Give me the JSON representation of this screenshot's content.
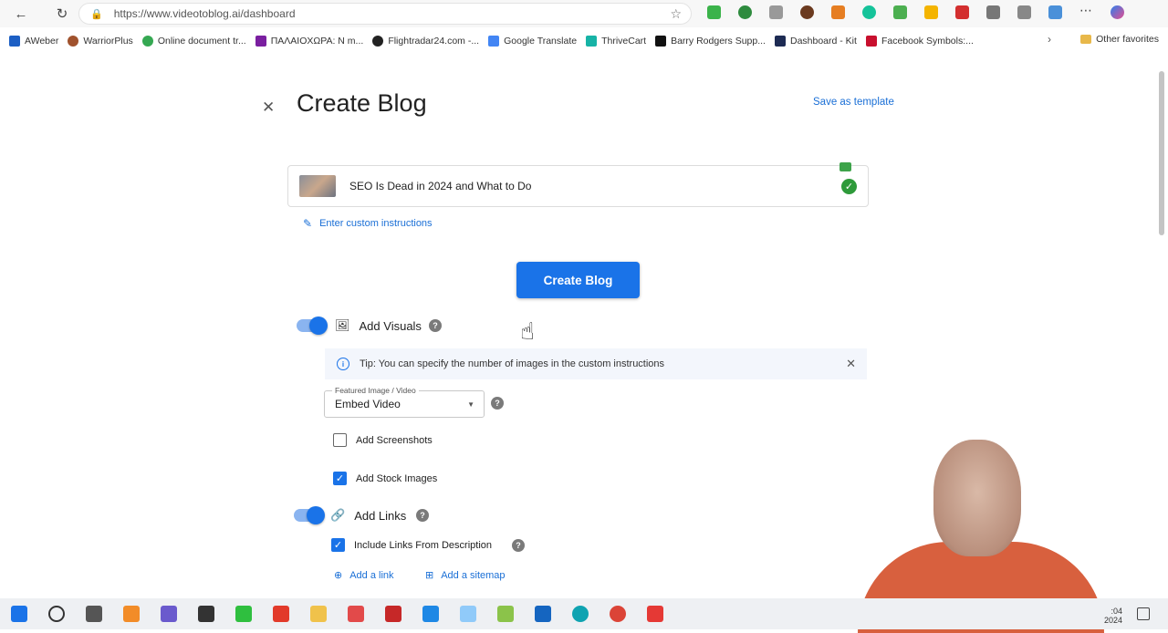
{
  "browser": {
    "url": "https://www.videotoblog.ai/dashboard",
    "bookmarks": [
      {
        "label": "AWeber",
        "color": "#1c5fc4"
      },
      {
        "label": "WarriorPlus",
        "color": "#a0522d"
      },
      {
        "label": "Online document tr...",
        "color": "#35a852"
      },
      {
        "label": "ΠΑΛΑΙΟΧΩΡΑ: Ν m...",
        "color": "#7a1fa0"
      },
      {
        "label": "Flightradar24.com -...",
        "color": "#222222"
      },
      {
        "label": "Google Translate",
        "color": "#4285f4"
      },
      {
        "label": "ThriveCart",
        "color": "#17b3a6"
      },
      {
        "label": "Barry Rodgers Supp...",
        "color": "#111111"
      },
      {
        "label": "Dashboard - Kit",
        "color": "#1d2b53"
      },
      {
        "label": "Facebook Symbols:...",
        "color": "#c8102e"
      }
    ],
    "other_favorites": "Other favorites"
  },
  "page": {
    "title": "Create Blog",
    "save_template": "Save as template",
    "video_title": "SEO Is Dead in 2024 and What to Do",
    "custom_instructions": "Enter custom instructions",
    "create_button": "Create Blog",
    "add_visuals": "Add Visuals",
    "tip": "Tip: You can specify the number of images in the custom instructions",
    "featured_label": "Featured Image / Video",
    "featured_value": "Embed Video",
    "add_screenshots": "Add Screenshots",
    "add_stock_images": "Add Stock Images",
    "add_links": "Add Links",
    "include_links": "Include Links From Description",
    "add_a_link": "Add a link",
    "add_a_sitemap": "Add a sitemap"
  },
  "taskbar": {
    "time_fragment": ":04",
    "date_fragment": "2024"
  }
}
